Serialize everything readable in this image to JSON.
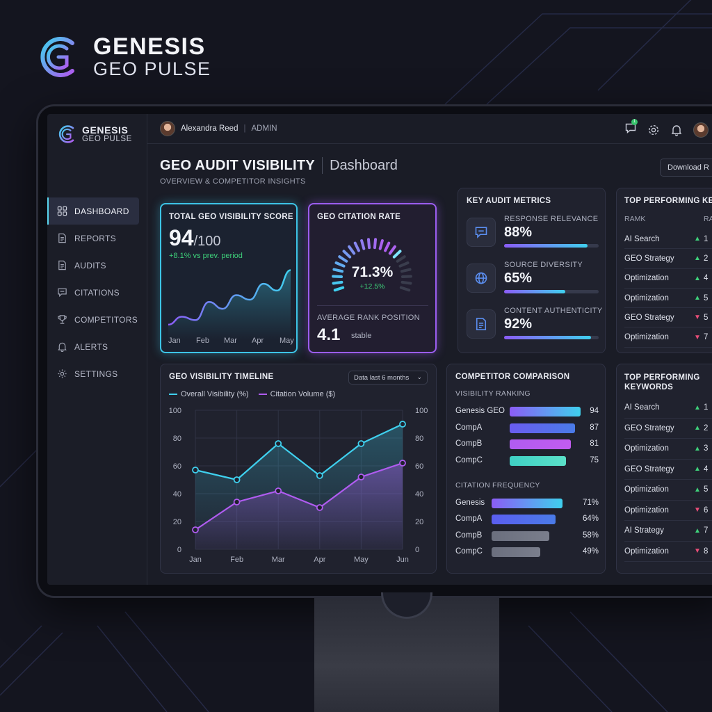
{
  "brand": {
    "name": "GENESIS",
    "sub": "GEO PULSE"
  },
  "user": {
    "name": "Alexandra Reed",
    "role": "ADMIN",
    "notifications": "1"
  },
  "nav": [
    {
      "label": "DASHBOARD",
      "icon": "grid-icon",
      "active": true
    },
    {
      "label": "REPORTS",
      "icon": "document-icon"
    },
    {
      "label": "AUDITS",
      "icon": "document-icon"
    },
    {
      "label": "CITATIONS",
      "icon": "chat-icon"
    },
    {
      "label": "COMPETITORS",
      "icon": "trophy-icon"
    },
    {
      "label": "ALERTS",
      "icon": "bell-icon"
    },
    {
      "label": "SETTINGS",
      "icon": "gear-icon"
    }
  ],
  "page": {
    "title": "GEO AUDIT VISIBILITY",
    "title2": "Dashboard",
    "subtitle": "OVERVIEW & COMPETITOR INSIGHTS",
    "download": "Download R"
  },
  "score": {
    "title": "TOTAL GEO VISIBILITY SCORE",
    "value": "94",
    "denominator": "/100",
    "change": "+8.1% vs prev. period",
    "months": [
      "Jan",
      "Feb",
      "Mar",
      "Apr",
      "May"
    ],
    "sparkline": [
      48,
      55,
      52,
      68,
      62,
      74,
      70,
      84,
      78,
      96
    ]
  },
  "rate": {
    "title": "GEO CITATION RATE",
    "value": "71.3%",
    "change": "+12.5%",
    "gauge_fraction": 0.713,
    "rank_title": "AVERAGE RANK POSITION",
    "rank_value": "4.1",
    "rank_status": "stable"
  },
  "metrics": {
    "title": "KEY AUDIT METRICS",
    "items": [
      {
        "label": "RESPONSE RELEVANCE",
        "value": "88%",
        "fraction": 0.88,
        "icon": "chat-icon"
      },
      {
        "label": "SOURCE DIVERSITY",
        "value": "65%",
        "fraction": 0.65,
        "icon": "globe-icon"
      },
      {
        "label": "CONTENT AUTHENTICITY",
        "value": "92%",
        "fraction": 0.92,
        "icon": "document-icon"
      }
    ]
  },
  "top1": {
    "title": "TOP PERFORMING KEY",
    "col1": "RAMK",
    "col2": "RAN",
    "rows": [
      {
        "kw": "AI Search",
        "dir": "up",
        "rank": "1"
      },
      {
        "kw": "GEO Strategy",
        "dir": "up",
        "rank": "2"
      },
      {
        "kw": "Optimization",
        "dir": "up",
        "rank": "4"
      },
      {
        "kw": "Optimization",
        "dir": "up",
        "rank": "5"
      },
      {
        "kw": "GEO Strategy",
        "dir": "down",
        "rank": "5"
      },
      {
        "kw": "Optimization",
        "dir": "down",
        "rank": "7"
      }
    ]
  },
  "timeline": {
    "title": "GEO VISIBILITY TIMELINE",
    "range": "Data last 6 months",
    "legend": [
      "Overall Visibility (%)",
      "Citation Volume ($)"
    ]
  },
  "chart_data": {
    "type": "line",
    "title": "GEO VISIBILITY TIMELINE",
    "x": [
      "Jan",
      "Feb",
      "Mar",
      "Apr",
      "May",
      "Jun"
    ],
    "series": [
      {
        "name": "Overall Visibility (%)",
        "values": [
          57,
          50,
          76,
          53,
          76,
          90
        ],
        "color": "#3fd0ee"
      },
      {
        "name": "Citation Volume ($)",
        "values": [
          14,
          34,
          42,
          30,
          52,
          62
        ],
        "color": "#b05cf0"
      }
    ],
    "ylim": [
      0,
      100
    ],
    "yticks": [
      0,
      20,
      40,
      60,
      80,
      100
    ],
    "grid": true,
    "legend": "top-left"
  },
  "competitors": {
    "title": "COMPETITOR COMPARISON",
    "ranking_title": "VISIBILITY RANKING",
    "ranking": [
      {
        "name": "Genesis GEO",
        "value": 94,
        "label": "94",
        "color": "#8b5cf6,#3fd0ee"
      },
      {
        "name": "CompA",
        "value": 87,
        "label": "87",
        "color": "#6a5cf0,#4a7be8"
      },
      {
        "name": "CompB",
        "value": 81,
        "label": "81",
        "color": "#b05cf0,#c25cf0"
      },
      {
        "name": "CompC",
        "value": 75,
        "label": "75",
        "color": "#3fd0c4,#5be0c8"
      }
    ],
    "citation_title": "CITATION FREQUENCY",
    "citation": [
      {
        "name": "Genesis",
        "value": 71,
        "label": "71%",
        "color": "#8b5cf6,#3fd0ee"
      },
      {
        "name": "CompA",
        "value": 64,
        "label": "64%",
        "color": "#5b5ef0,#4a7be8"
      },
      {
        "name": "CompB",
        "value": 58,
        "label": "58%",
        "color": "#6b6f7e,#7a7e8c"
      },
      {
        "name": "CompC",
        "value": 49,
        "label": "49%",
        "color": "#6b6f7e,#7a7e8c"
      }
    ]
  },
  "top2": {
    "title": "TOP PERFORMING KEYWORDS",
    "rows": [
      {
        "kw": "AI Search",
        "dir": "up",
        "rank": "1"
      },
      {
        "kw": "GEO Strategy",
        "dir": "up",
        "rank": "2"
      },
      {
        "kw": "Optimization",
        "dir": "up",
        "rank": "3"
      },
      {
        "kw": "GEO Strategy",
        "dir": "up",
        "rank": "4"
      },
      {
        "kw": "Optimization",
        "dir": "up",
        "rank": "5"
      },
      {
        "kw": "Optimization",
        "dir": "down",
        "rank": "6"
      },
      {
        "kw": "AI Strategy",
        "dir": "up",
        "rank": "7"
      },
      {
        "kw": "Optimization",
        "dir": "down",
        "rank": "8"
      }
    ]
  }
}
